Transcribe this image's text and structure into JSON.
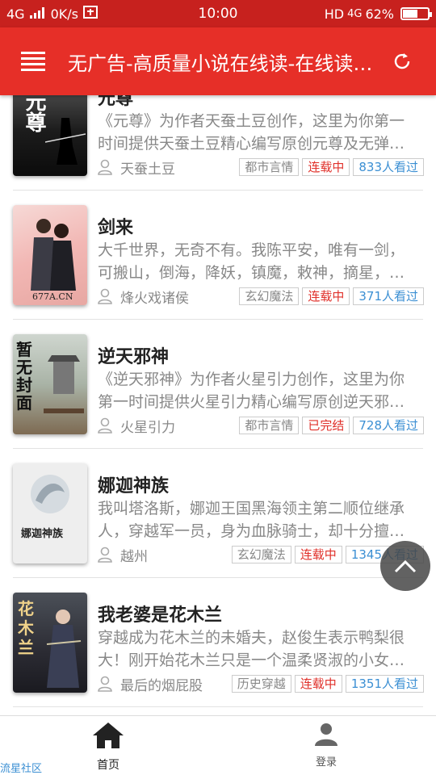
{
  "status_bar": {
    "network": "4G",
    "speed": "0K/s",
    "time": "10:00",
    "hd": "HD",
    "network2": "4G",
    "battery": "62%",
    "battery_level": 0.62
  },
  "app_bar": {
    "title": "无广告-高质量小说在线读-在线读…"
  },
  "books": [
    {
      "title": "元尊",
      "description": "《元尊》为作者天蚕土豆创作，这里为你第一时间提供天蚕土豆精心编写原创元尊及无弹…",
      "author": "天蚕土豆",
      "genre": "都市言情",
      "status": "连载中",
      "views": "833人看过",
      "cover_text": "元尊"
    },
    {
      "title": "剑来",
      "description": "大千世界，无奇不有。我陈平安，唯有一剑，可搬山，倒海，降妖，镇魔，敕神，摘星，…",
      "author": "烽火戏诸侯",
      "genre": "玄幻魔法",
      "status": "连载中",
      "views": "371人看过",
      "cover_text": "677A.CN"
    },
    {
      "title": "逆天邪神",
      "description": "《逆天邪神》为作者火星引力创作，这里为你第一时间提供火星引力精心编写原创逆天邪…",
      "author": "火星引力",
      "genre": "都市言情",
      "status": "已完结",
      "views": "728人看过",
      "cover_text": "暂无封面"
    },
    {
      "title": "娜迦神族",
      "description": "我叫塔洛斯，娜迦王国黑海领主第二顺位继承人，穿越军一员，身为血脉骑士，却十分擅…",
      "author": "越州",
      "genre": "玄幻魔法",
      "status": "连载中",
      "views": "1345人看过",
      "cover_text": "娜迦神族"
    },
    {
      "title": "我老婆是花木兰",
      "description": "穿越成为花木兰的未婚夫，赵俊生表示鸭梨很大！刚开始花木兰只是一个温柔贤淑的小女…",
      "author": "最后的烟屁股",
      "genre": "历史穿越",
      "status": "连载中",
      "views": "1351人看过",
      "cover_text": "花木兰"
    }
  ],
  "bottom_nav": {
    "home_label": "首页",
    "login_label": "登录"
  },
  "watermark": "流星社区",
  "colors": {
    "status_bar": "#c7211e",
    "app_bar": "#e62f28",
    "status_tag": "#e0302a",
    "views_tag": "#3b8fd3"
  }
}
